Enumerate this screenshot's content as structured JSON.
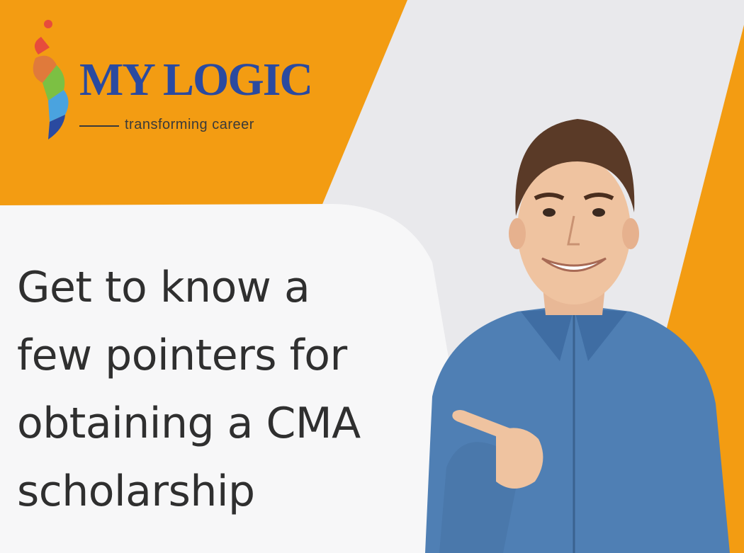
{
  "brand": {
    "name": "MY LOGIC",
    "tagline": "transforming career"
  },
  "headline": {
    "lines": [
      "Get to know a",
      "few pointers for",
      "obtaining a CMA",
      "scholarship"
    ]
  },
  "colors": {
    "brand_orange": "#f39c12",
    "panel_gray": "#e9e9ec",
    "text_panel": "#f7f7f8",
    "logo_blue": "#2a4aa0",
    "shirt_denim": "#4f7fb4"
  },
  "image": {
    "subject": "smiling-young-man-pointing-icon"
  }
}
